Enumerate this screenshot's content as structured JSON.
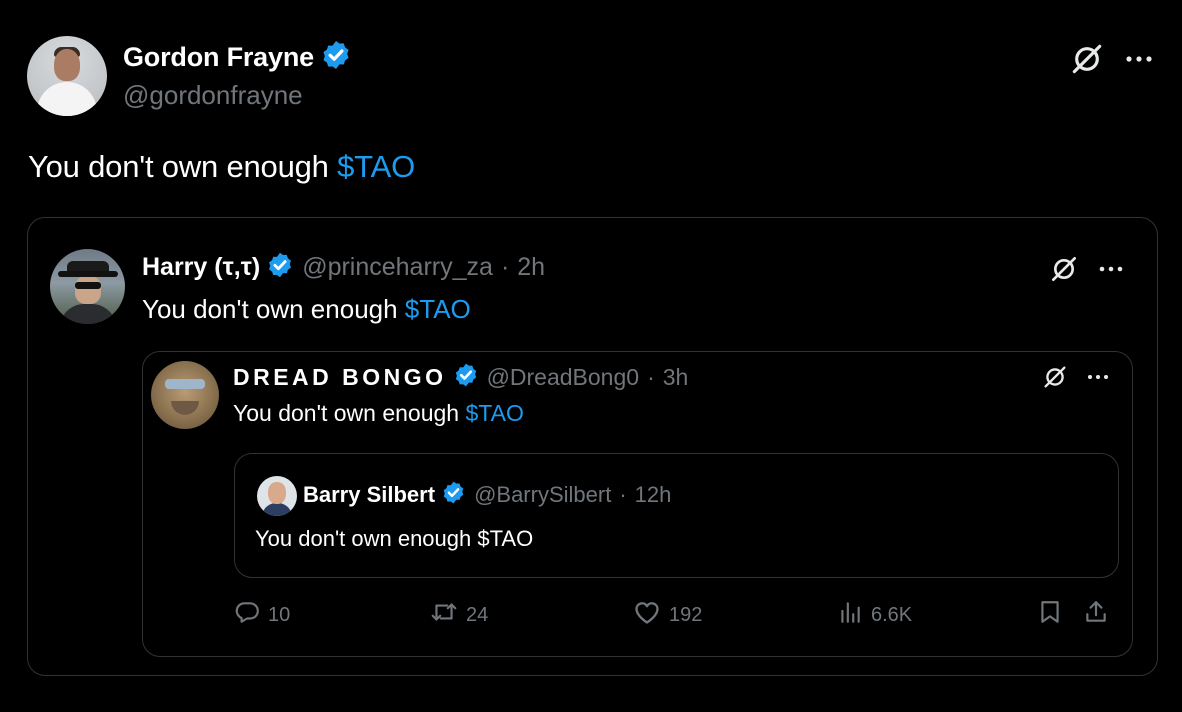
{
  "outer": {
    "author_name": "Gordon Frayne",
    "handle": "@gordonfrayne",
    "text_prefix": "You don't own enough ",
    "cashtag": "$TAO"
  },
  "quote1": {
    "author_name": "Harry (τ,τ)",
    "handle": "@princeharry_za",
    "separator": "·",
    "time": "2h",
    "text_prefix": "You don't own enough ",
    "cashtag": "$TAO"
  },
  "quote2": {
    "author_name": "DREAD BONGO",
    "handle": "@DreadBong0",
    "separator": "·",
    "time": "3h",
    "text_prefix": "You don't own enough ",
    "cashtag": "$TAO"
  },
  "quote3": {
    "author_name": "Barry Silbert",
    "handle": "@BarrySilbert",
    "separator": "·",
    "time": "12h",
    "text": "You don't own enough $TAO"
  },
  "actions": {
    "replies": "10",
    "reposts": "24",
    "likes": "192",
    "views": "6.6K"
  },
  "colors": {
    "background": "#000000",
    "accent": "#1d9bf0",
    "muted": "#71767b",
    "border": "#2f3336"
  },
  "icons": [
    "verified-badge-icon",
    "grok-icon",
    "more-icon",
    "reply-icon",
    "repost-icon",
    "like-icon",
    "views-icon",
    "bookmark-icon",
    "share-icon"
  ]
}
